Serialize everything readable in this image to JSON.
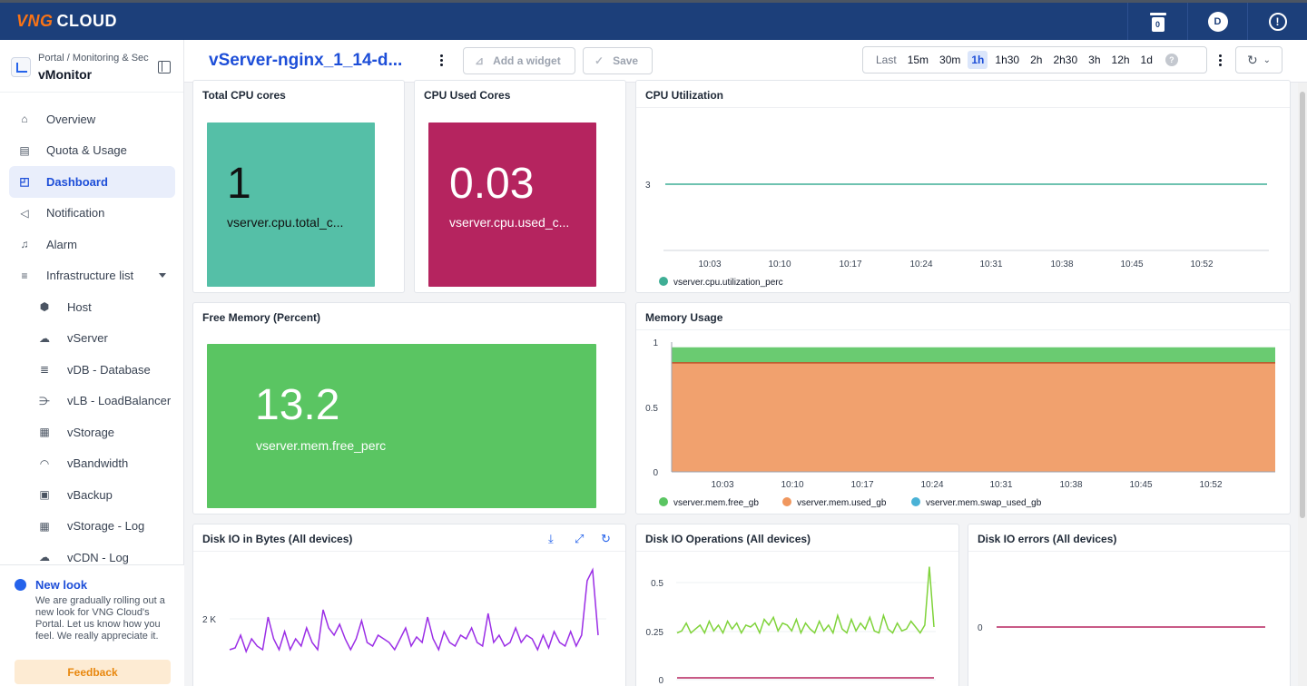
{
  "topbar": {
    "logo_brand": "VNG",
    "logo_text": "CLOUD",
    "trash_count": "0",
    "avatar_initial": "D",
    "alert_glyph": "!"
  },
  "sidebar": {
    "breadcrumb": "Portal  /  Monitoring & Sec",
    "app_name": "vMonitor",
    "items": [
      {
        "label": "Overview",
        "icon": "home-icon"
      },
      {
        "label": "Quota & Usage",
        "icon": "quota-icon"
      },
      {
        "label": "Dashboard",
        "icon": "dashboard-icon",
        "active": true
      },
      {
        "label": "Notification",
        "icon": "megaphone-icon"
      },
      {
        "label": "Alarm",
        "icon": "bell-icon"
      },
      {
        "label": "Infrastructure list",
        "icon": "infrastructure-icon"
      }
    ],
    "subitems": [
      {
        "label": "Host",
        "icon": "host-icon"
      },
      {
        "label": "vServer",
        "icon": "cloud-server-icon"
      },
      {
        "label": "vDB - Database",
        "icon": "database-icon"
      },
      {
        "label": "vLB - LoadBalancer",
        "icon": "loadbalancer-icon"
      },
      {
        "label": "vStorage",
        "icon": "storage-icon"
      },
      {
        "label": "vBandwidth",
        "icon": "gauge-icon"
      },
      {
        "label": "vBackup",
        "icon": "backup-icon"
      },
      {
        "label": "vStorage - Log",
        "icon": "storage-log-icon"
      },
      {
        "label": "vCDN - Log",
        "icon": "cdn-icon"
      }
    ],
    "new_look": {
      "title": "New look",
      "text": "We are gradually rolling out a new look for VNG Cloud's Portal. Let us know how you feel. We really appreciate it.",
      "feedback_label": "Feedback"
    }
  },
  "toolbar": {
    "dashboard_title": "vServer-nginx_1_14-d...",
    "add_widget_label": "Add a widget",
    "save_label": "Save",
    "range_label": "Last",
    "range_options": [
      "15m",
      "30m",
      "1h",
      "1h30",
      "2h",
      "2h30",
      "3h",
      "12h",
      "1d"
    ],
    "range_selected": "1h",
    "help_glyph": "?"
  },
  "panels": {
    "total_cpu": {
      "title": "Total CPU cores",
      "value": "1",
      "metric": "vserver.cpu.total_c...",
      "color": "#55bfa7"
    },
    "cpu_used": {
      "title": "CPU Used Cores",
      "value": "0.03",
      "metric": "vserver.cpu.used_c...",
      "color": "#b5245f"
    },
    "free_mem": {
      "title": "Free Memory (Percent)",
      "value": "13.2",
      "metric": "vserver.mem.free_perc",
      "color": "#5ac562"
    },
    "cpu_util": {
      "title": "CPU Utilization"
    },
    "mem_usage": {
      "title": "Memory Usage"
    },
    "disk_bytes": {
      "title": "Disk IO in Bytes (All devices)"
    },
    "disk_ops": {
      "title": "Disk IO Operations (All devices)"
    },
    "disk_errors": {
      "title": "Disk IO errors (All devices)"
    }
  },
  "chart_data": [
    {
      "type": "line",
      "title": "CPU Utilization",
      "x": [
        "10:03",
        "10:10",
        "10:17",
        "10:24",
        "10:31",
        "10:38",
        "10:45",
        "10:52"
      ],
      "yticks": [
        "3"
      ],
      "series": [
        {
          "name": "vserver.cpu.utilization_perc",
          "color": "#3fae95",
          "values": [
            3,
            3,
            3,
            3,
            3,
            3,
            3,
            3,
            3
          ]
        }
      ]
    },
    {
      "type": "area",
      "title": "Memory Usage",
      "x": [
        "10:03",
        "10:10",
        "10:17",
        "10:24",
        "10:31",
        "10:38",
        "10:45",
        "10:52"
      ],
      "yticks": [
        "0",
        "0.5",
        "1"
      ],
      "ylim": [
        0,
        1
      ],
      "series": [
        {
          "name": "vserver.mem.free_gb",
          "color": "#5ac562",
          "value": 0.12
        },
        {
          "name": "vserver.mem.used_gb",
          "color": "#f0975e",
          "value": 0.84
        },
        {
          "name": "vserver.mem.swap_used_gb",
          "color": "#4ab2d6",
          "value": 0
        }
      ]
    },
    {
      "type": "line",
      "title": "Disk IO in Bytes (All devices)",
      "yticks": [
        "2 K"
      ],
      "ylim": [
        0,
        4000
      ],
      "series": [
        {
          "name": "",
          "color": "#9b2ee6",
          "values": [
            1300,
            1350,
            1700,
            1250,
            1600,
            1400,
            1300,
            2200,
            1600,
            1300,
            1800,
            1300,
            1600,
            1400,
            1900,
            1500,
            1300,
            2400,
            1900,
            1700,
            2000,
            1600,
            1300,
            1600,
            2100,
            1500,
            1400,
            1700,
            1600,
            1500,
            1300,
            1600,
            1900,
            1400,
            1650,
            1500,
            2200,
            1600,
            1300,
            1800,
            1500,
            1400,
            1700,
            1600,
            1900,
            1500,
            1400,
            2300,
            1500,
            1700,
            1400,
            1500,
            1900,
            1500,
            1700,
            1600,
            1300,
            1700,
            1350,
            1800,
            1500,
            1400,
            1800,
            1400,
            1700,
            3200,
            3500,
            1700
          ]
        }
      ]
    },
    {
      "type": "line",
      "title": "Disk IO Operations (All devices)",
      "yticks": [
        "0",
        "0.25",
        "0.5"
      ],
      "ylim": [
        0,
        0.6
      ],
      "series": [
        {
          "name": "",
          "color": "#7fd33a",
          "values": [
            0.24,
            0.25,
            0.29,
            0.24,
            0.26,
            0.28,
            0.24,
            0.3,
            0.25,
            0.28,
            0.24,
            0.3,
            0.26,
            0.29,
            0.24,
            0.28,
            0.27,
            0.29,
            0.24,
            0.31,
            0.28,
            0.32,
            0.25,
            0.29,
            0.28,
            0.25,
            0.31,
            0.24,
            0.29,
            0.26,
            0.24,
            0.3,
            0.25,
            0.28,
            0.24,
            0.33,
            0.26,
            0.24,
            0.31,
            0.25,
            0.29,
            0.26,
            0.32,
            0.25,
            0.24,
            0.33,
            0.26,
            0.24,
            0.29,
            0.25,
            0.26,
            0.3,
            0.27,
            0.24,
            0.28,
            0.58,
            0.27
          ]
        },
        {
          "name": "",
          "color": "#b5245f",
          "values": [
            0,
            0,
            0,
            0,
            0,
            0,
            0,
            0
          ]
        }
      ]
    },
    {
      "type": "line",
      "title": "Disk IO errors (All devices)",
      "yticks": [
        "0"
      ],
      "series": [
        {
          "name": "",
          "color": "#b5245f",
          "values": [
            0,
            0,
            0,
            0,
            0,
            0,
            0,
            0
          ]
        }
      ]
    }
  ]
}
